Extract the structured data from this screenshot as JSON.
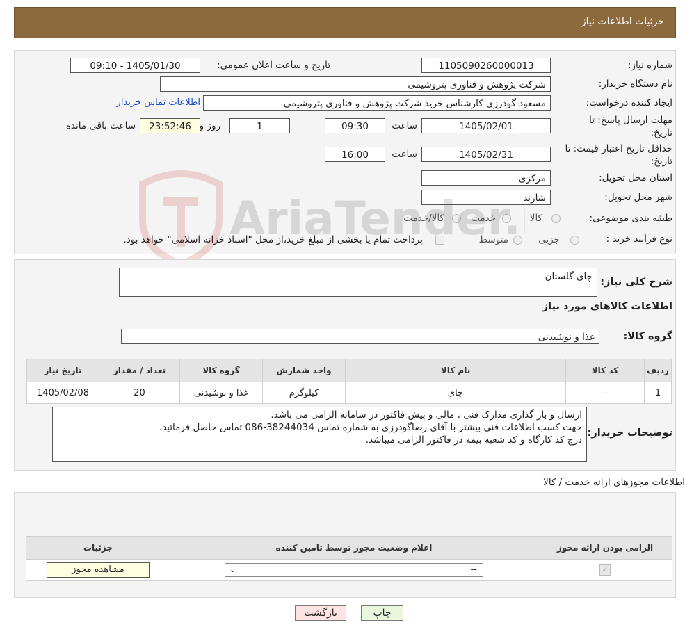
{
  "header": {
    "title": "جزئیات اطلاعات نیاز"
  },
  "info": {
    "need_number_label": "شماره نیاز:",
    "need_number": "1105090260000013",
    "announce_label": "تاریخ و ساعت اعلان عمومی:",
    "announce_value": "1405/01/30 - 09:10",
    "buyer_org_label": "نام دستگاه خریدار:",
    "buyer_org": "شرکت پژوهش و فناوری پتروشیمی",
    "creator_label": "ایجاد کننده درخواست:",
    "creator": "مسعود گودرزی کارشناس خرید شرکت پژوهش و فناوری پتروشیمی",
    "contact_link": "اطلاعات تماس خریدار",
    "deadline_label_1": "مهلت ارسال پاسخ: تا",
    "deadline_label_2": "تاریخ:",
    "deadline_date": "1405/02/01",
    "time_label": "ساعت",
    "deadline_time": "09:30",
    "days_value": "1",
    "days_label": "روز و",
    "remaining_time": "23:52:46",
    "remaining_label": "ساعت باقی مانده",
    "validity_label_1": "حداقل تاریخ اعتبار قیمت: تا",
    "validity_label_2": "تاریخ:",
    "validity_date": "1405/02/31",
    "validity_time_label": "ساعت",
    "validity_time": "16:00",
    "province_label": "استان محل تحویل:",
    "province": "مرکزی",
    "city_label": "شهر محل تحویل:",
    "city": "شازند",
    "category_label": "طبقه بندی موضوعی:",
    "category_options": [
      "کالا",
      "خدمت",
      "کالا/خدمت"
    ],
    "process_label": "نوع فرآیند خرید :",
    "process_options": [
      "جزیی",
      "متوسط"
    ],
    "process_note": "پرداخت تمام یا بخشی از مبلغ خرید،از محل \"اسناد خزانه اسلامی\" خواهد بود."
  },
  "watermark": "AriaTender.neT",
  "need": {
    "summary_label": "شرح کلی نیاز:",
    "summary": "چای گلستان",
    "goods_title": "اطلاعات کالاهای مورد نیاز",
    "group_label": "گروه کالا:",
    "group": "غذا و نوشیدنی"
  },
  "goods_table": {
    "headers": [
      "ردیف",
      "کد کالا",
      "نام کالا",
      "واحد شمارش",
      "گروه کالا",
      "تعداد / مقدار",
      "تاریخ نیاز"
    ],
    "rows": [
      [
        "1",
        "--",
        "چای",
        "کیلوگرم",
        "غذا و نوشیدنی",
        "20",
        "1405/02/08"
      ]
    ]
  },
  "buyer_notes": {
    "label": "توضیحات خریدار:",
    "lines": [
      "ارسال و بار گذاری مدارک فنی ، مالی و پیش فاکتور در سامانه الزامی می باشد.",
      "جهت کسب اطلاعات فنی بیشتر با آقای رضاگودرزی به شماره تماس 38244034-086 تماس حاصل فرمائید.",
      "درج کد کارگاه و کد شعبه بیمه  در فاکتور الزامی میباشد."
    ]
  },
  "permits": {
    "title": "اطلاعات مجوزهای ارائه خدمت / کالا",
    "headers": [
      "الزامی بودن ارائه مجوز",
      "اعلام وضعیت مجوز توسط تامین کننده",
      "جزئیات"
    ],
    "select_value": "--",
    "view_button": "مشاهده مجوز"
  },
  "buttons": {
    "print": "چاپ",
    "back": "بازگشت"
  }
}
